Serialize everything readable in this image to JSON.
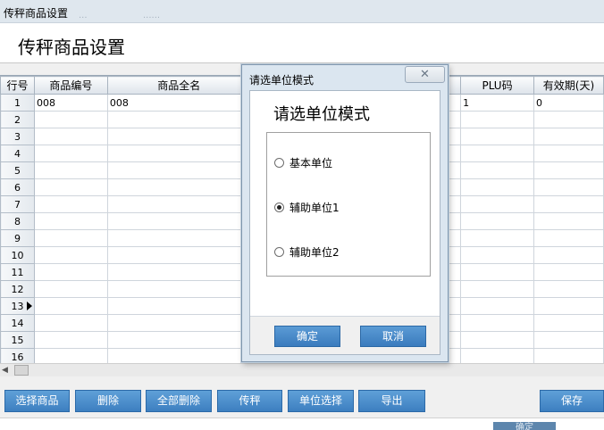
{
  "window": {
    "title": "传秤商品设置",
    "ghost_left": "...",
    "ghost_right": "......"
  },
  "header": {
    "title": "传秤商品设置"
  },
  "grid": {
    "columns": [
      "行号",
      "商品编号",
      "商品全名",
      "",
      "",
      "",
      "",
      "PLU码",
      "有效期(天)"
    ],
    "rows": [
      {
        "no": "1",
        "code": "008",
        "name": "008",
        "plu": "1",
        "expiry": "0"
      },
      {
        "no": "2",
        "code": "",
        "name": "",
        "plu": "",
        "expiry": ""
      },
      {
        "no": "3",
        "code": "",
        "name": "",
        "plu": "",
        "expiry": ""
      },
      {
        "no": "4",
        "code": "",
        "name": "",
        "plu": "",
        "expiry": ""
      },
      {
        "no": "5",
        "code": "",
        "name": "",
        "plu": "",
        "expiry": ""
      },
      {
        "no": "6",
        "code": "",
        "name": "",
        "plu": "",
        "expiry": ""
      },
      {
        "no": "7",
        "code": "",
        "name": "",
        "plu": "",
        "expiry": ""
      },
      {
        "no": "8",
        "code": "",
        "name": "",
        "plu": "",
        "expiry": ""
      },
      {
        "no": "9",
        "code": "",
        "name": "",
        "plu": "",
        "expiry": ""
      },
      {
        "no": "10",
        "code": "",
        "name": "",
        "plu": "",
        "expiry": ""
      },
      {
        "no": "11",
        "code": "",
        "name": "",
        "plu": "",
        "expiry": ""
      },
      {
        "no": "12",
        "code": "",
        "name": "",
        "plu": "",
        "expiry": ""
      },
      {
        "no": "13",
        "code": "",
        "name": "",
        "plu": "",
        "expiry": "",
        "current": true
      },
      {
        "no": "14",
        "code": "",
        "name": "",
        "plu": "",
        "expiry": ""
      },
      {
        "no": "15",
        "code": "",
        "name": "",
        "plu": "",
        "expiry": ""
      },
      {
        "no": "16",
        "code": "",
        "name": "",
        "plu": "",
        "expiry": ""
      }
    ]
  },
  "toolbar": {
    "select_goods": "选择商品",
    "delete": "删除",
    "delete_all": "全部删除",
    "transfer": "传秤",
    "unit_select": "单位选择",
    "export": "导出",
    "save": "保存"
  },
  "footer": {
    "ghost_button": "确定"
  },
  "dialog": {
    "title": "请选单位模式",
    "close_icon": "close-icon",
    "close_glyph": "✕",
    "heading": "请选单位模式",
    "options": [
      {
        "label": "基本单位",
        "checked": false
      },
      {
        "label": "辅助单位1",
        "checked": true
      },
      {
        "label": "辅助单位2",
        "checked": false
      }
    ],
    "ok": "确定",
    "cancel": "取消"
  },
  "colors": {
    "button_blue": "#3d7fc0",
    "dialog_bg": "#dbe6f0",
    "titlebar_bg": "#dfe7ee"
  }
}
